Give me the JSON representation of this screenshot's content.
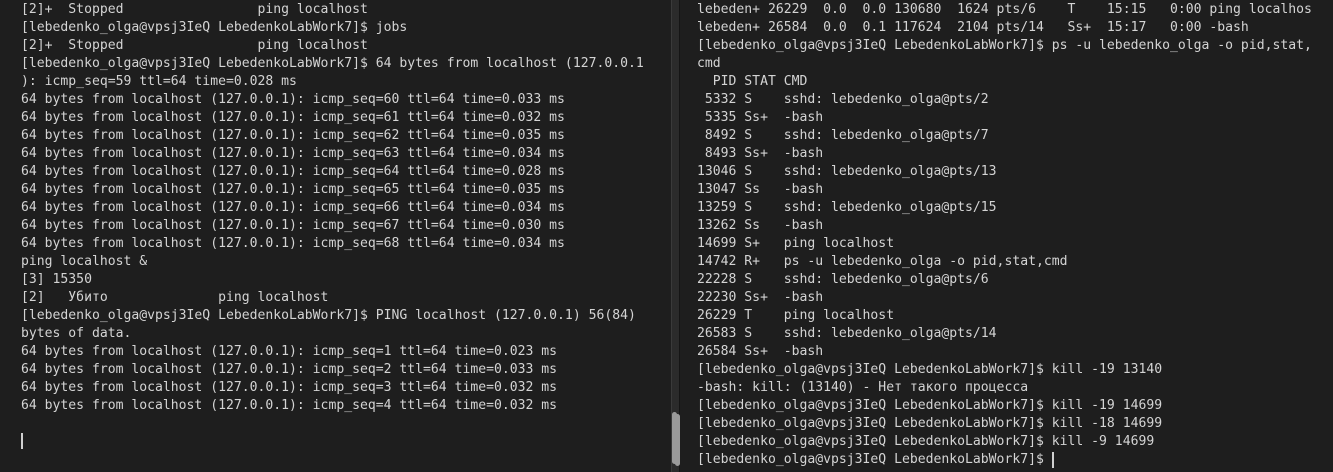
{
  "left_terminal": {
    "lines": [
      "[2]+  Stopped                 ping localhost",
      "[lebedenko_olga@vpsj3IeQ LebedenkoLabWork7]$ jobs",
      "[2]+  Stopped                 ping localhost",
      "[lebedenko_olga@vpsj3IeQ LebedenkoLabWork7]$ 64 bytes from localhost (127.0.0.1",
      "): icmp_seq=59 ttl=64 time=0.028 ms",
      "64 bytes from localhost (127.0.0.1): icmp_seq=60 ttl=64 time=0.033 ms",
      "64 bytes from localhost (127.0.0.1): icmp_seq=61 ttl=64 time=0.032 ms",
      "64 bytes from localhost (127.0.0.1): icmp_seq=62 ttl=64 time=0.035 ms",
      "64 bytes from localhost (127.0.0.1): icmp_seq=63 ttl=64 time=0.034 ms",
      "64 bytes from localhost (127.0.0.1): icmp_seq=64 ttl=64 time=0.028 ms",
      "64 bytes from localhost (127.0.0.1): icmp_seq=65 ttl=64 time=0.035 ms",
      "64 bytes from localhost (127.0.0.1): icmp_seq=66 ttl=64 time=0.034 ms",
      "64 bytes from localhost (127.0.0.1): icmp_seq=67 ttl=64 time=0.030 ms",
      "64 bytes from localhost (127.0.0.1): icmp_seq=68 ttl=64 time=0.034 ms",
      "ping localhost &",
      "[3] 15350",
      "[2]   Убито              ping localhost",
      "[lebedenko_olga@vpsj3IeQ LebedenkoLabWork7]$ PING localhost (127.0.0.1) 56(84)",
      "bytes of data.",
      "64 bytes from localhost (127.0.0.1): icmp_seq=1 ttl=64 time=0.023 ms",
      "64 bytes from localhost (127.0.0.1): icmp_seq=2 ttl=64 time=0.033 ms",
      "64 bytes from localhost (127.0.0.1): icmp_seq=3 ttl=64 time=0.032 ms",
      "64 bytes from localhost (127.0.0.1): icmp_seq=4 ttl=64 time=0.032 ms"
    ]
  },
  "right_terminal": {
    "lines": [
      "lebeden+ 26229  0.0  0.0 130680  1624 pts/6    T    15:15   0:00 ping localhos",
      "lebeden+ 26584  0.0  0.1 117624  2104 pts/14   Ss+  15:17   0:00 -bash",
      "[lebedenko_olga@vpsj3IeQ LebedenkoLabWork7]$ ps -u lebedenko_olga -o pid,stat,",
      "cmd",
      "  PID STAT CMD",
      " 5332 S    sshd: lebedenko_olga@pts/2",
      " 5335 Ss+  -bash",
      " 8492 S    sshd: lebedenko_olga@pts/7",
      " 8493 Ss+  -bash",
      "13046 S    sshd: lebedenko_olga@pts/13",
      "13047 Ss   -bash",
      "13259 S    sshd: lebedenko_olga@pts/15",
      "13262 Ss   -bash",
      "14699 S+   ping localhost",
      "14742 R+   ps -u lebedenko_olga -o pid,stat,cmd",
      "22228 S    sshd: lebedenko_olga@pts/6",
      "22230 Ss+  -bash",
      "26229 T    ping localhost",
      "26583 S    sshd: lebedenko_olga@pts/14",
      "26584 Ss+  -bash",
      "[lebedenko_olga@vpsj3IeQ LebedenkoLabWork7]$ kill -19 13140",
      "-bash: kill: (13140) - Нет такого процесса",
      "[lebedenko_olga@vpsj3IeQ LebedenkoLabWork7]$ kill -19 14699",
      "[lebedenko_olga@vpsj3IeQ LebedenkoLabWork7]$ kill -18 14699",
      "[lebedenko_olga@vpsj3IeQ LebedenkoLabWork7]$ kill -9 14699",
      "[lebedenko_olga@vpsj3IeQ LebedenkoLabWork7]$ "
    ]
  },
  "colors": {
    "background": "#1e1e1e",
    "foreground": "#d4d4d4",
    "divider": "#2b2b2b",
    "scrollbar": "#9a9a9a"
  }
}
